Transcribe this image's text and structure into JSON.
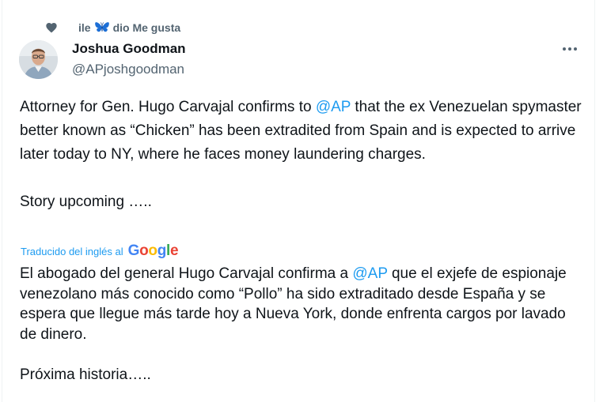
{
  "social_context": {
    "prefix": "ile",
    "emoji_icon": "butterfly-icon",
    "suffix": "dio Me gusta"
  },
  "author": {
    "name": "Joshua Goodman",
    "handle": "@APjoshgoodman"
  },
  "tweet": {
    "line1_before": "Attorney for Gen. Hugo Carvajal confirms to ",
    "mention": "@AP",
    "line1_after": " that the ex Venezuelan spymaster better known as “Chicken” has been extradited from Spain and is expected to arrive later today to NY, where he faces money laundering charges.",
    "footer": "Story upcoming ….."
  },
  "translation": {
    "label": "Traducido del inglés al",
    "provider": "Google",
    "text_before": "El abogado del general Hugo Carvajal confirma a ",
    "mention": "@AP",
    "text_after": " que el exjefe de espionaje venezolano más conocido como “Pollo” ha sido extraditado desde España y se espera que llegue más tarde hoy a Nueva York, donde enfrenta cargos por lavado de dinero.",
    "footer": "Próxima historia….."
  },
  "colors": {
    "link": "#1d9bf0",
    "secondary_text": "#536471",
    "primary_text": "#0f1419"
  }
}
